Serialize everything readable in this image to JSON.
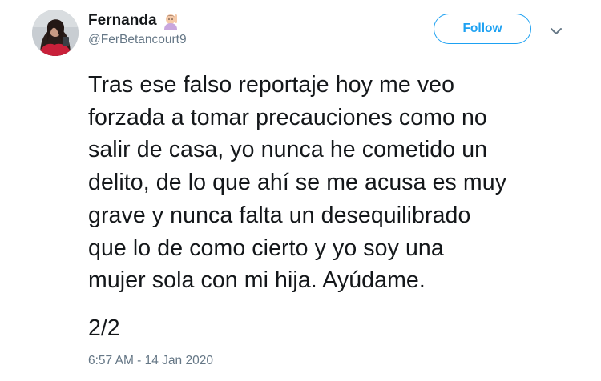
{
  "author": {
    "display_name": "Fernanda",
    "handle": "@FerBetancourt9",
    "name_emoji": "woman-raising-hand-emoji",
    "avatar": "profile-photo"
  },
  "actions": {
    "follow_label": "Follow",
    "more_icon": "chevron-down-icon"
  },
  "tweet": {
    "lines": [
      "Tras ese falso reportaje hoy me veo",
      "forzada a tomar precauciones como no",
      "salir de casa, yo nunca he cometido un",
      "delito, de lo que ahí se me acusa es muy",
      "grave y nunca falta un desequilibrado",
      "que lo de como cierto y yo soy una",
      "mujer sola con mi hija. Ayúdame."
    ],
    "part": "2/2",
    "timestamp": "6:57 AM - 14 Jan 2020"
  },
  "colors": {
    "accent": "#1da1f2",
    "text": "#14171a",
    "secondary_text": "#657786"
  }
}
